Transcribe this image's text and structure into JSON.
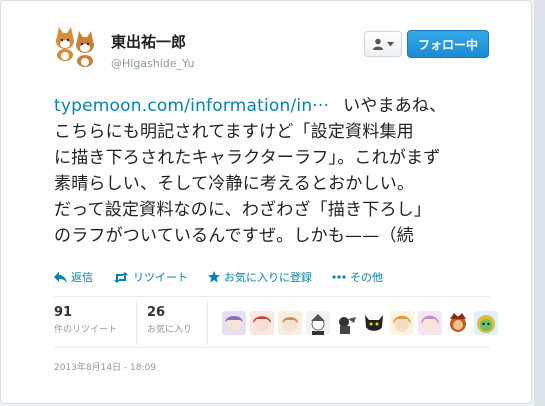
{
  "author": {
    "display_name": "東出祐一郎",
    "handle": "@Higashide_Yu"
  },
  "buttons": {
    "follow_label": "フォロー中",
    "user_menu_icon": "person-icon"
  },
  "tweet": {
    "link_text": "typemoon.com/information/in···",
    "lines": [
      "いやまあね、",
      "こちらにも明記されてますけど「設定資料集用",
      "に描き下ろされたキャラクターラフ」。これがまず",
      "素晴らしい、そして冷静に考えるとおかしい。",
      "だって設定資料なのに、わざわざ「描き下ろし」",
      "のラフがついているんですぜ。しかも——（続"
    ]
  },
  "actions": {
    "reply": "返信",
    "retweet": "リツイート",
    "favorite": "お気に入りに登録",
    "more": "その他"
  },
  "stats": {
    "retweets_count": "91",
    "retweets_label": "件のリツイート",
    "favorites_count": "26",
    "favorites_label": "お気に入り"
  },
  "timestamp": "2013年8月14日 - 18:09",
  "colors": {
    "link": "#0084b4",
    "follow_button": "#1d8ad2",
    "secondary_text": "#8899a6"
  }
}
